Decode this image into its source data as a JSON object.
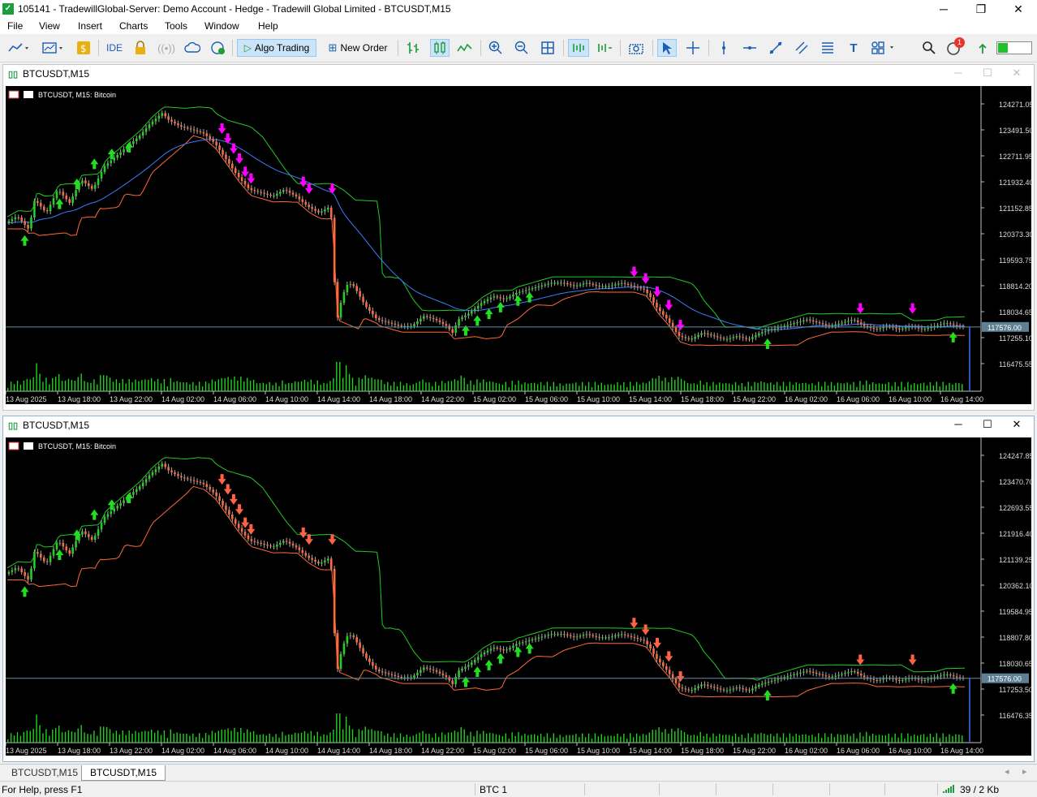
{
  "window": {
    "title": "105141 - TradewillGlobal-Server: Demo Account - Hedge - Tradewill Global Limited - BTCUSDT,M15",
    "minimize": "─",
    "restore": "❐",
    "close": "✕"
  },
  "menu": [
    "File",
    "View",
    "Insert",
    "Charts",
    "Tools",
    "Window",
    "Help"
  ],
  "toolbar": {
    "ide": "IDE",
    "algo_trading": "Algo Trading",
    "new_order": "New Order",
    "notification_count": "1"
  },
  "charts": [
    {
      "window_title": "BTCUSDT,M15",
      "chart_label": "BTCUSDT, M15:  Bitcoin",
      "price_labels": [
        "124271.05",
        "123491.50",
        "122711.95",
        "121932.40",
        "121152.85",
        "120373.30",
        "119593.75",
        "118814.20",
        "118034.65",
        "117255.10",
        "116475.55"
      ],
      "current_price": "117576.00",
      "time_labels": [
        "13 Aug 2025",
        "13 Aug 18:00",
        "13 Aug 22:00",
        "14 Aug 02:00",
        "14 Aug 06:00",
        "14 Aug 10:00",
        "14 Aug 14:00",
        "14 Aug 18:00",
        "14 Aug 22:00",
        "15 Aug 02:00",
        "15 Aug 06:00",
        "15 Aug 10:00",
        "15 Aug 14:00",
        "15 Aug 18:00",
        "15 Aug 22:00",
        "16 Aug 02:00",
        "16 Aug 06:00",
        "16 Aug 10:00",
        "16 Aug 14:00"
      ],
      "sell_arrow_color": "#ff00ff",
      "has_ma": true,
      "window_buttons_enabled": false
    },
    {
      "window_title": "BTCUSDT,M15",
      "chart_label": "BTCUSDT, M15:  Bitcoin",
      "price_labels": [
        "124247.85",
        "123470.70",
        "122693.55",
        "121916.40",
        "121139.25",
        "120362.10",
        "119584.95",
        "118807.80",
        "118030.65",
        "117253.50",
        "116476.35"
      ],
      "current_price": "117576.00",
      "time_labels": [
        "13 Aug 2025",
        "13 Aug 18:00",
        "13 Aug 22:00",
        "14 Aug 02:00",
        "14 Aug 06:00",
        "14 Aug 10:00",
        "14 Aug 14:00",
        "14 Aug 18:00",
        "14 Aug 22:00",
        "15 Aug 02:00",
        "15 Aug 06:00",
        "15 Aug 10:00",
        "15 Aug 14:00",
        "15 Aug 18:00",
        "15 Aug 22:00",
        "16 Aug 02:00",
        "16 Aug 06:00",
        "16 Aug 10:00",
        "16 Aug 14:00"
      ],
      "sell_arrow_color": "#ff6347",
      "has_ma": false,
      "window_buttons_enabled": true
    }
  ],
  "tabs": [
    "BTCUSDT,M15",
    "BTCUSDT,M15"
  ],
  "status": {
    "help": "For Help, press F1",
    "profile": "BTC 1",
    "traffic": "39 / 2 Kb"
  },
  "colors": {
    "upper_channel": "#22cc22",
    "lower_channel": "#ff6a3d",
    "moving_average": "#3a7bff",
    "buy_arrow": "#22dd22",
    "price_line": "#5f8fa8"
  },
  "price_series": [
    [
      0,
      120700
    ],
    [
      2,
      120900
    ],
    [
      4,
      120500
    ],
    [
      5,
      121400
    ],
    [
      7,
      121000
    ],
    [
      9,
      121700
    ],
    [
      11,
      121300
    ],
    [
      13,
      122000
    ],
    [
      15,
      121700
    ],
    [
      17,
      122400
    ],
    [
      19,
      122700
    ],
    [
      21,
      123000
    ],
    [
      23,
      123300
    ],
    [
      25,
      123700
    ],
    [
      27,
      124000
    ],
    [
      28,
      123800
    ],
    [
      30,
      123600
    ],
    [
      32,
      123500
    ],
    [
      34,
      123400
    ],
    [
      36,
      123100
    ],
    [
      38,
      122600
    ],
    [
      40,
      122100
    ],
    [
      42,
      121700
    ],
    [
      44,
      121600
    ],
    [
      46,
      121500
    ],
    [
      48,
      121700
    ],
    [
      50,
      121500
    ],
    [
      52,
      121200
    ],
    [
      54,
      121000
    ],
    [
      56,
      121200
    ],
    [
      57,
      117700
    ],
    [
      58,
      118500
    ],
    [
      59,
      118900
    ],
    [
      60,
      118800
    ],
    [
      62,
      118200
    ],
    [
      64,
      117800
    ],
    [
      66,
      117700
    ],
    [
      68,
      117600
    ],
    [
      70,
      117600
    ],
    [
      72,
      117900
    ],
    [
      74,
      117800
    ],
    [
      76,
      117600
    ],
    [
      77,
      117400
    ],
    [
      78,
      117800
    ],
    [
      80,
      118000
    ],
    [
      82,
      118300
    ],
    [
      84,
      118500
    ],
    [
      86,
      118400
    ],
    [
      88,
      118600
    ],
    [
      90,
      118700
    ],
    [
      92,
      118800
    ],
    [
      94,
      118900
    ],
    [
      96,
      118900
    ],
    [
      98,
      118800
    ],
    [
      100,
      118900
    ],
    [
      102,
      118800
    ],
    [
      104,
      118800
    ],
    [
      106,
      118900
    ],
    [
      108,
      118800
    ],
    [
      110,
      118700
    ],
    [
      111,
      118500
    ],
    [
      112,
      118200
    ],
    [
      114,
      117800
    ],
    [
      116,
      117300
    ],
    [
      118,
      117200
    ],
    [
      120,
      117400
    ],
    [
      122,
      117300
    ],
    [
      124,
      117200
    ],
    [
      126,
      117300
    ],
    [
      128,
      117200
    ],
    [
      130,
      117400
    ],
    [
      132,
      117500
    ],
    [
      134,
      117600
    ],
    [
      136,
      117700
    ],
    [
      138,
      117800
    ],
    [
      140,
      117700
    ],
    [
      142,
      117600
    ],
    [
      144,
      117700
    ],
    [
      146,
      117800
    ],
    [
      148,
      117600
    ],
    [
      150,
      117500
    ],
    [
      152,
      117600
    ],
    [
      154,
      117500
    ],
    [
      156,
      117600
    ],
    [
      158,
      117500
    ],
    [
      160,
      117600
    ],
    [
      162,
      117700
    ],
    [
      164,
      117600
    ],
    [
      165,
      117576
    ]
  ],
  "buy_signals": [
    [
      3,
      120500
    ],
    [
      9,
      121600
    ],
    [
      12,
      122200
    ],
    [
      15,
      122800
    ],
    [
      18,
      123100
    ],
    [
      21,
      123300
    ],
    [
      79,
      117800
    ],
    [
      81,
      118100
    ],
    [
      83,
      118300
    ],
    [
      85,
      118500
    ],
    [
      88,
      118700
    ],
    [
      90,
      118800
    ],
    [
      131,
      117400
    ],
    [
      163,
      117600
    ]
  ],
  "sell_signals": [
    [
      37,
      123200
    ],
    [
      38,
      122900
    ],
    [
      39,
      122600
    ],
    [
      40,
      122300
    ],
    [
      41,
      121900
    ],
    [
      42,
      121700
    ],
    [
      51,
      121600
    ],
    [
      52,
      121400
    ],
    [
      56,
      121400
    ],
    [
      108,
      118900
    ],
    [
      110,
      118700
    ],
    [
      112,
      118300
    ],
    [
      114,
      117900
    ],
    [
      116,
      117300
    ],
    [
      147,
      117800
    ],
    [
      156,
      117800
    ]
  ]
}
